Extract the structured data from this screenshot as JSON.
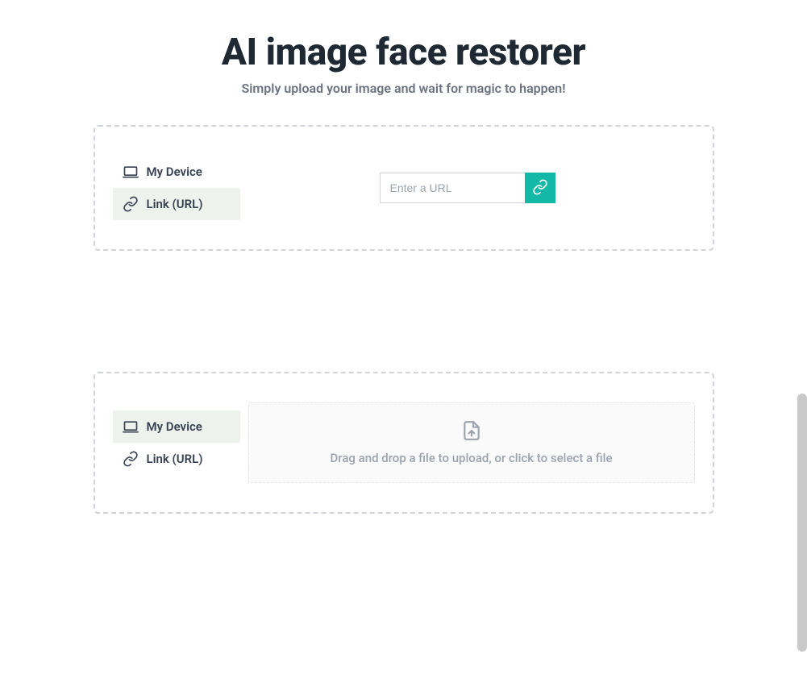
{
  "header": {
    "title": "AI image face restorer",
    "subtitle": "Simply upload your image and wait for magic to happen!"
  },
  "tabs": {
    "device": "My Device",
    "link": "Link (URL)"
  },
  "url": {
    "placeholder": "Enter a URL"
  },
  "dropzone": {
    "text": "Drag and drop a file to upload, or click to select a file"
  },
  "colors": {
    "accent": "#14b8a6"
  }
}
